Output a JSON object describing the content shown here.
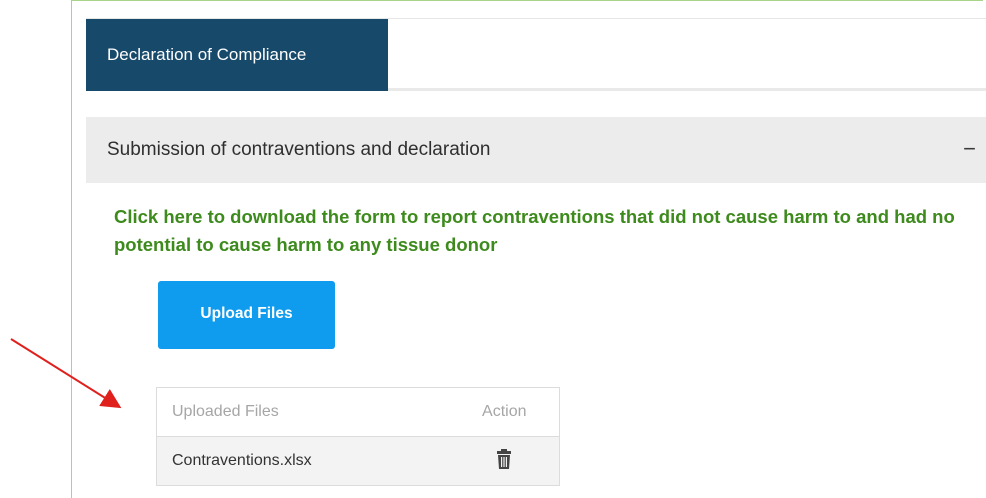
{
  "tabs": [
    {
      "label": "Declaration of Compliance",
      "active": true
    }
  ],
  "section": {
    "title": "Submission of contraventions and declaration",
    "collapse_symbol": "−"
  },
  "download_link": {
    "text": "Click here to download the form to report contraventions that did not cause harm to and had no potential to cause harm to any tissue donor"
  },
  "upload": {
    "label": "Upload Files"
  },
  "files_table": {
    "headers": [
      "Uploaded Files",
      "Action"
    ],
    "rows": [
      {
        "name": "Contraventions.xlsx",
        "action_icon": "trash-icon"
      }
    ]
  },
  "colors": {
    "tab_active": "#17496b",
    "link": "#3d8a1d",
    "button": "#109cee",
    "annotation_arrow": "#e0201c"
  }
}
